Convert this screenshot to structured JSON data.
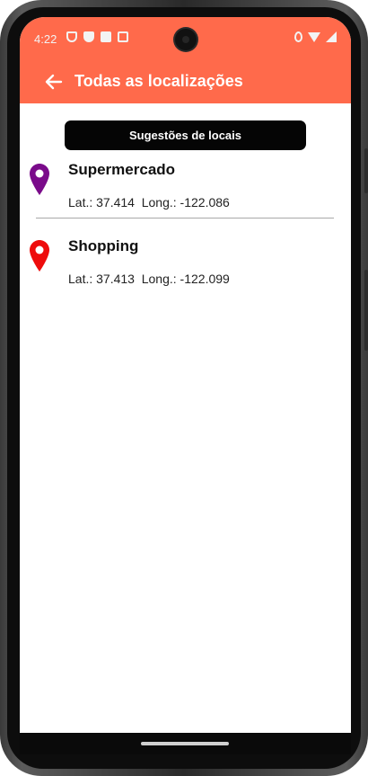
{
  "status_bar": {
    "time": "4:22"
  },
  "app_bar": {
    "title": "Todas as localizações",
    "back_icon": "arrow-left-icon",
    "color": "#ff6a4b"
  },
  "suggest_button": {
    "label": "Sugestões de locais"
  },
  "locations": [
    {
      "name": "Supermercado",
      "coords": "Lat.: 37.414  Long.: -122.086",
      "pin_icon": "map-pin-icon",
      "pin_color": "#7a0b8a"
    },
    {
      "name": "Shopping",
      "coords": "Lat.: 37.413  Long.: -122.099",
      "pin_icon": "map-pin-icon",
      "pin_color": "#ee0c0c"
    }
  ]
}
